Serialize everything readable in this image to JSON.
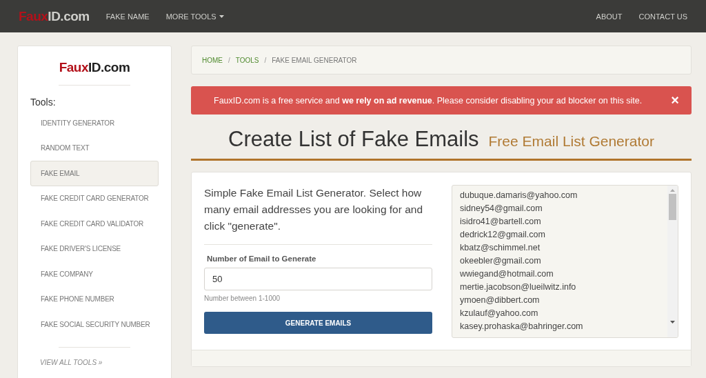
{
  "navbar": {
    "logo": {
      "accent": "Faux",
      "rest": "ID.com"
    },
    "links": [
      {
        "label": "FAKE NAME",
        "kind": "link"
      },
      {
        "label": "MORE TOOLS",
        "kind": "dropdown"
      }
    ],
    "right_links": [
      "ABOUT",
      "CONTACT US"
    ]
  },
  "sidebar": {
    "logo": {
      "accent": "Faux",
      "rest": "ID.com"
    },
    "heading": "Tools:",
    "items": [
      {
        "label": "IDENTITY GENERATOR",
        "selected": false
      },
      {
        "label": "RANDOM TEXT",
        "selected": false
      },
      {
        "label": "FAKE EMAIL",
        "selected": true
      },
      {
        "label": "FAKE CREDIT CARD GENERATOR",
        "selected": false
      },
      {
        "label": "FAKE CREDIT CARD VALIDATOR",
        "selected": false
      },
      {
        "label": "FAKE DRIVER'S LICENSE",
        "selected": false
      },
      {
        "label": "FAKE COMPANY",
        "selected": false
      },
      {
        "label": "FAKE PHONE NUMBER",
        "selected": false
      },
      {
        "label": "FAKE SOCIAL SECURITY NUMBER",
        "selected": false
      }
    ],
    "view_all": "VIEW ALL TOOLS »"
  },
  "breadcrumb": [
    {
      "label": "HOME",
      "kind": "link"
    },
    {
      "label": "/",
      "kind": "separator"
    },
    {
      "label": "TOOLS",
      "kind": "link"
    },
    {
      "label": "/",
      "kind": "separator"
    },
    {
      "label": "FAKE EMAIL GENERATOR",
      "kind": "current"
    }
  ],
  "alert": {
    "text": "FauxID.com is a free service and **we rely on ad revenue**. Please consider disabling your ad blocker on this site.",
    "close": "×"
  },
  "title": "Create List of Fake Emails",
  "subtitle": "Free Email List Generator",
  "form": {
    "description": "Simple Fake Email List Generator. Select how many email addresses you are looking for and click \"generate\".",
    "label": "Number of Email to Generate",
    "value": "50",
    "help": "Number between 1-1000",
    "button": "GENERATE EMAILS"
  },
  "emails": [
    "dubuque.damaris@yahoo.com",
    "sidney54@gmail.com",
    "isidro41@bartell.com",
    "dedrick12@gmail.com",
    "kbatz@schimmel.net",
    "okeebler@gmail.com",
    "wwiegand@hotmail.com",
    "mertie.jacobson@lueilwitz.info",
    "ymoen@dibbert.com",
    "kzulauf@yahoo.com",
    "kasey.prohaska@bahringer.com"
  ]
}
